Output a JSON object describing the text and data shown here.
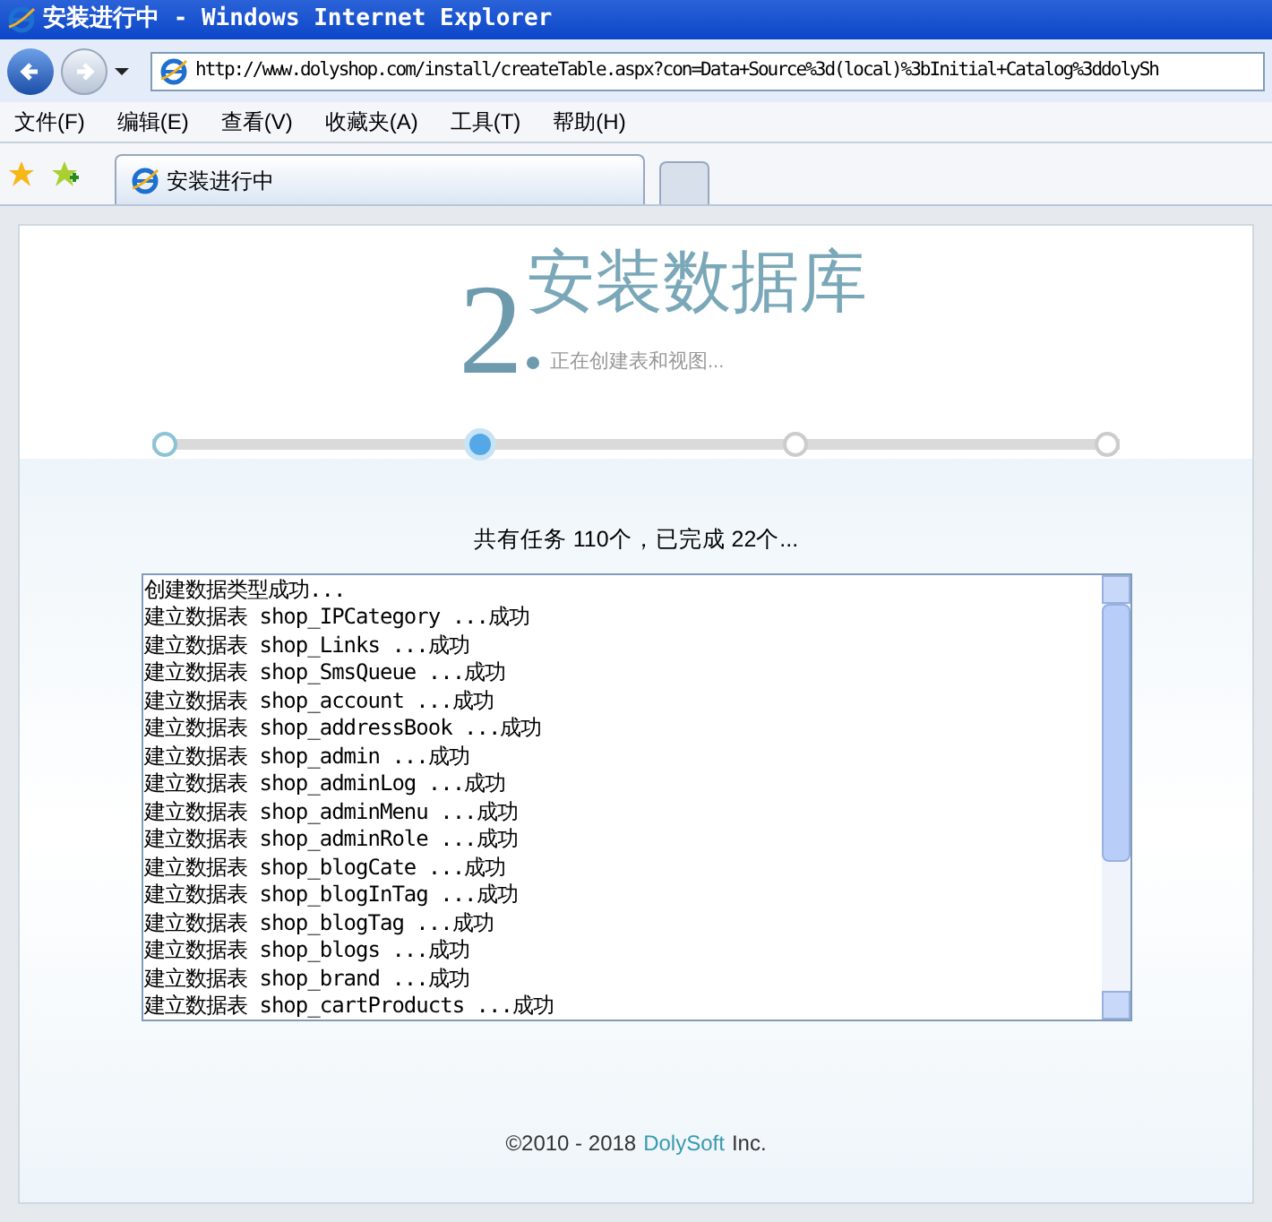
{
  "window": {
    "title": "安装进行中 - Windows Internet Explorer"
  },
  "address_bar": {
    "url": "http://www.dolyshop.com/install/createTable.aspx?con=Data+Source%3d(local)%3bInitial+Catalog%3ddolySh"
  },
  "menu": [
    "文件(F)",
    "编辑(E)",
    "查看(V)",
    "收藏夹(A)",
    "工具(T)",
    "帮助(H)"
  ],
  "tabs": [
    {
      "label": "安装进行中",
      "selected": true
    }
  ],
  "page": {
    "step_number": "2",
    "heading": "安装数据库",
    "subheading": "正在创建表和视图...",
    "steps": [
      {
        "selected": false
      },
      {
        "selected": true
      },
      {
        "selected": false
      },
      {
        "selected": false
      }
    ],
    "progress_text": "共有任务 110个，已完成 22个...",
    "log": [
      "创建数据类型成功...",
      "建立数据表 shop_IPCategory ...成功",
      "建立数据表 shop_Links ...成功",
      "建立数据表 shop_SmsQueue ...成功",
      "建立数据表 shop_account ...成功",
      "建立数据表 shop_addressBook ...成功",
      "建立数据表 shop_admin ...成功",
      "建立数据表 shop_adminLog ...成功",
      "建立数据表 shop_adminMenu ...成功",
      "建立数据表 shop_adminRole ...成功",
      "建立数据表 shop_blogCate ...成功",
      "建立数据表 shop_blogInTag ...成功",
      "建立数据表 shop_blogTag ...成功",
      "建立数据表 shop_blogs ...成功",
      "建立数据表 shop_brand ...成功",
      "建立数据表 shop_cartProducts ...成功"
    ],
    "footer": {
      "copyright": "©2010 - 2018",
      "company": "DolySoft",
      "suffix": "Inc."
    }
  }
}
